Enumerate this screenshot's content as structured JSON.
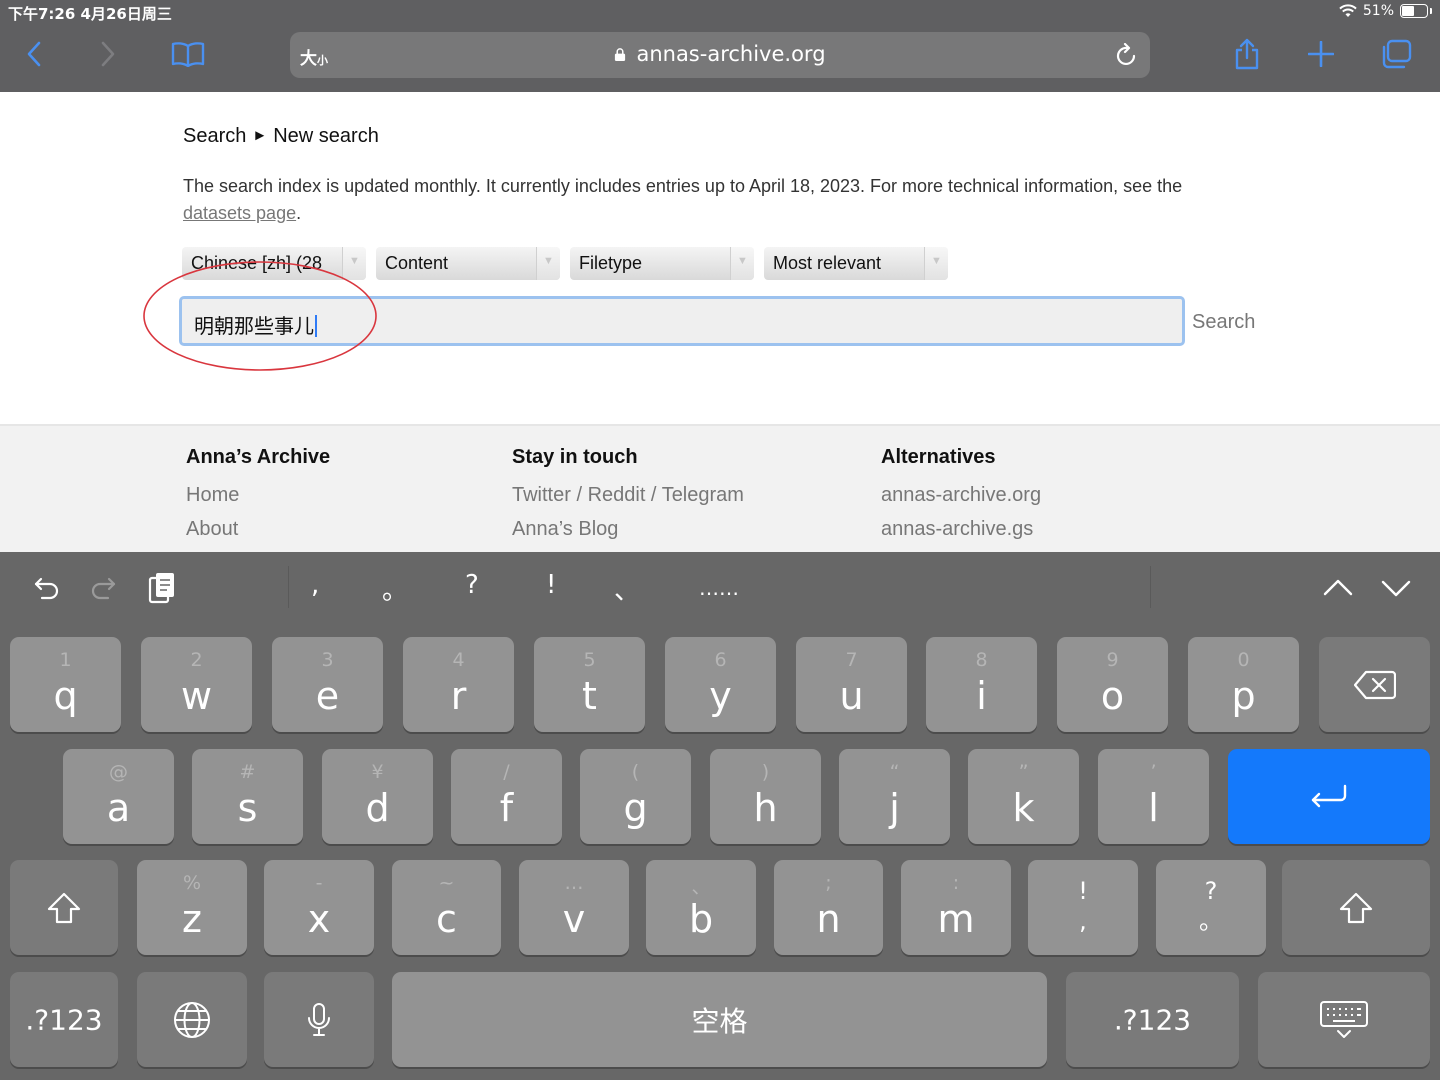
{
  "status": {
    "time_date": "下午7:26   4月26日周三",
    "battery": "51%",
    "battery_level": 0.51
  },
  "browser": {
    "text_size_label": "大",
    "text_size_small": "小",
    "url": "annas-archive.org",
    "icons": [
      "back-icon",
      "forward-icon",
      "bookmarks-icon",
      "lock-icon",
      "reload-icon",
      "share-icon",
      "new-tab-icon",
      "tabs-icon"
    ]
  },
  "page": {
    "breadcrumb": {
      "root": "Search",
      "arrow": "►",
      "current": "New search"
    },
    "info_text": "The search index is updated monthly. It currently includes entries up to April 18, 2023. For more technical information, see the ",
    "info_link": "datasets page",
    "info_end": ".",
    "filters": [
      {
        "label": "Chinese [zh] (28"
      },
      {
        "label": "Content"
      },
      {
        "label": "Filetype"
      },
      {
        "label": "Most relevant"
      }
    ],
    "search_value": "明朝那些事儿",
    "search_button": "Search",
    "annotation_color": "#d9363e"
  },
  "footer": {
    "col1": {
      "title": "Anna’s Archive",
      "links": [
        "Home",
        "About"
      ]
    },
    "col2": {
      "title": "Stay in touch",
      "links": [
        "Twitter / Reddit / Telegram",
        "Anna’s Blog"
      ]
    },
    "col3": {
      "title": "Alternatives",
      "links": [
        "annas-archive.org",
        "annas-archive.gs"
      ]
    }
  },
  "keyboard": {
    "punctuation": [
      ",",
      "。",
      "?",
      "!",
      "、",
      "……"
    ],
    "row1": [
      {
        "hint": "1",
        "key": "q"
      },
      {
        "hint": "2",
        "key": "w"
      },
      {
        "hint": "3",
        "key": "e"
      },
      {
        "hint": "4",
        "key": "r"
      },
      {
        "hint": "5",
        "key": "t"
      },
      {
        "hint": "6",
        "key": "y"
      },
      {
        "hint": "7",
        "key": "u"
      },
      {
        "hint": "8",
        "key": "i"
      },
      {
        "hint": "9",
        "key": "o"
      },
      {
        "hint": "0",
        "key": "p"
      }
    ],
    "row2": [
      {
        "hint": "@",
        "key": "a"
      },
      {
        "hint": "#",
        "key": "s"
      },
      {
        "hint": "¥",
        "key": "d"
      },
      {
        "hint": "/",
        "key": "f"
      },
      {
        "hint": "(",
        "key": "g"
      },
      {
        "hint": ")",
        "key": "h"
      },
      {
        "hint": "“",
        "key": "j"
      },
      {
        "hint": "”",
        "key": "k"
      },
      {
        "hint": "’",
        "key": "l"
      }
    ],
    "row3": [
      {
        "hint": "%",
        "key": "z"
      },
      {
        "hint": "-",
        "key": "x"
      },
      {
        "hint": "~",
        "key": "c"
      },
      {
        "hint": "…",
        "key": "v"
      },
      {
        "hint": "、",
        "key": "b"
      },
      {
        "hint": ";",
        "key": "n"
      },
      {
        "hint": ":",
        "key": "m"
      }
    ],
    "punct_keys": [
      {
        "top": "!",
        "bottom": ","
      },
      {
        "top": "?",
        "bottom": "。"
      }
    ],
    "numbers_label": ".?123",
    "space_label": "空格",
    "return_color": "#1479fb"
  }
}
